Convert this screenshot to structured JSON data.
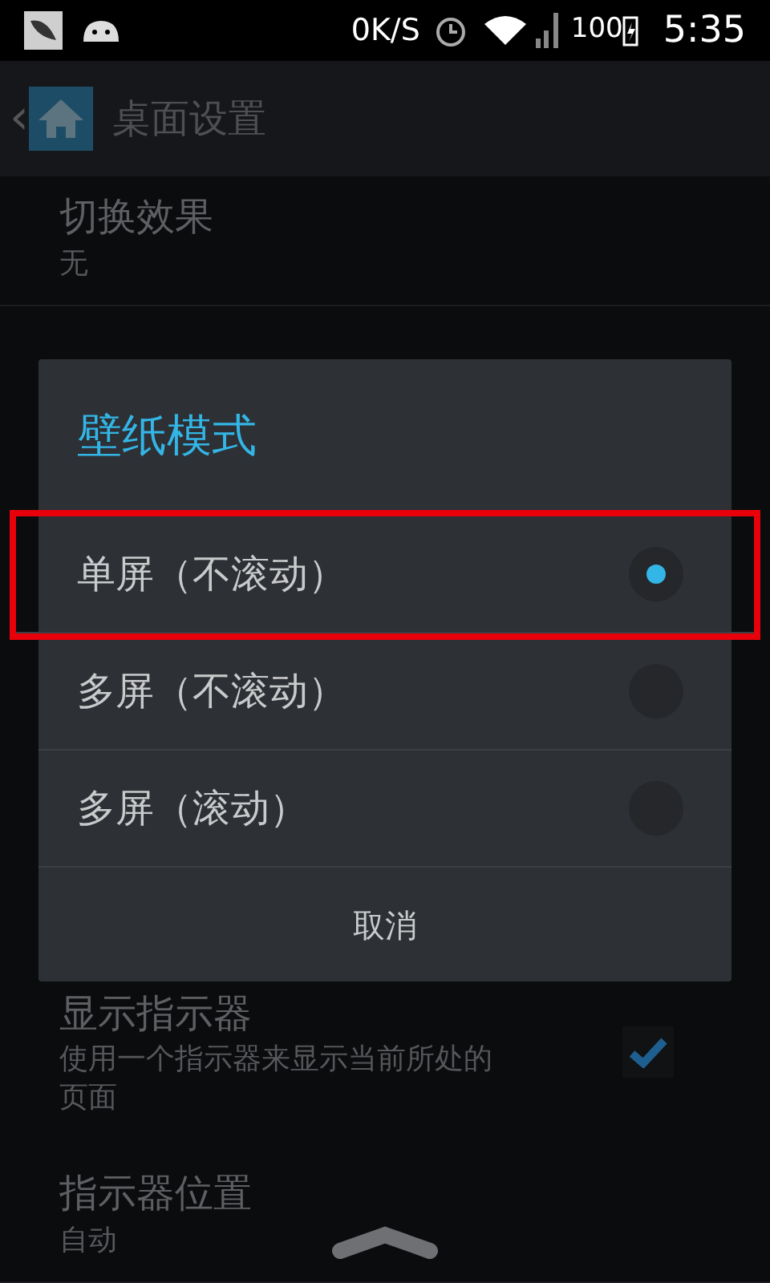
{
  "status_bar": {
    "speed": "0K/S",
    "battery": "100",
    "time": "5:35"
  },
  "action_bar": {
    "back": "‹",
    "title": "桌面设置"
  },
  "settings": [
    {
      "kind": "value",
      "title": "切换效果",
      "summary": "无"
    },
    {
      "kind": "checkbox",
      "title": "显示指示器",
      "summary": "使用一个指示器来显示当前所处的页面",
      "checked": true
    },
    {
      "kind": "value",
      "title": "指示器位置",
      "summary": "自动"
    }
  ],
  "dialog": {
    "title": "壁纸模式",
    "options": [
      {
        "label": "单屏（不滚动）",
        "selected": true,
        "highlighted": true
      },
      {
        "label": "多屏（不滚动）",
        "selected": false,
        "highlighted": false
      },
      {
        "label": "多屏（滚动）",
        "selected": false,
        "highlighted": false
      }
    ],
    "cancel": "取消"
  }
}
